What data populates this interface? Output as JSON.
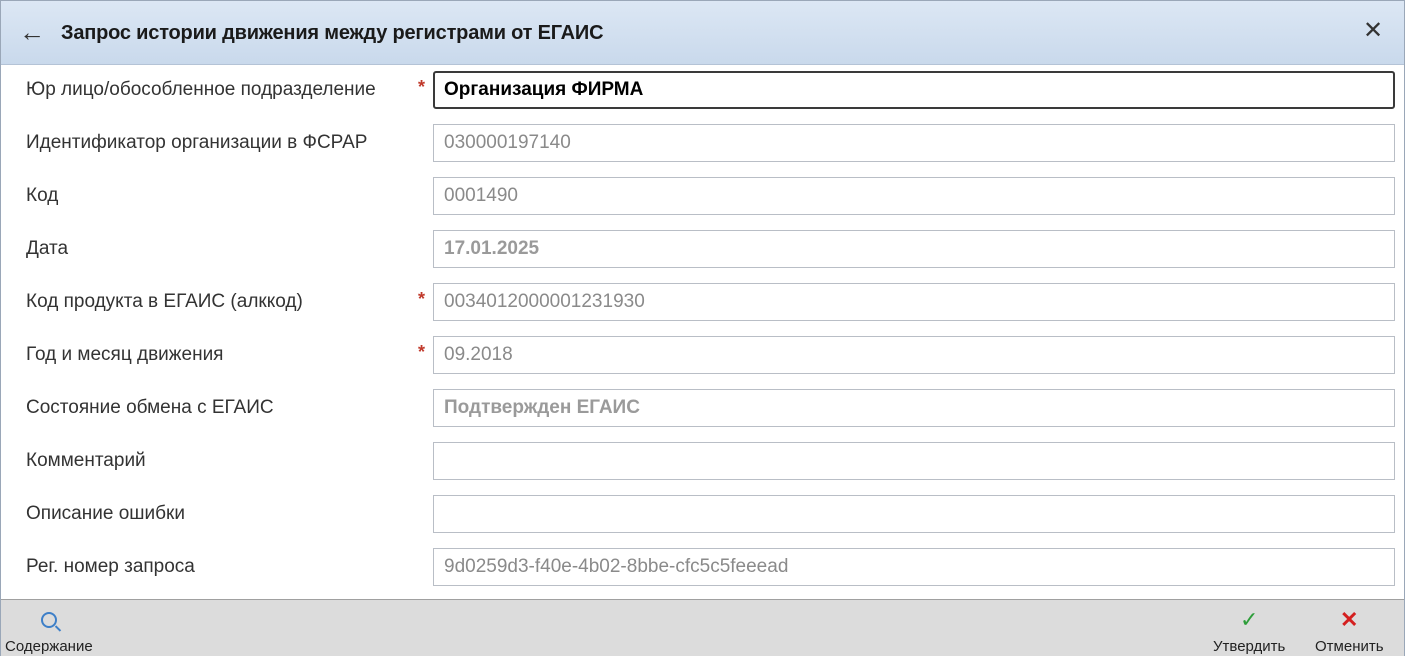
{
  "title": "Запрос истории движения между регистрами от ЕГАИС",
  "icons": {
    "back": "←",
    "close": "✕",
    "ok": "✓",
    "cancel": "✕"
  },
  "fields": [
    {
      "label": "Юр лицо/обособленное подразделение",
      "value": "Организация ФИРМА",
      "required": "*"
    },
    {
      "label": "Идентификатор организации в ФСРАР",
      "value": "030000197140",
      "required": ""
    },
    {
      "label": "Код",
      "value": "0001490",
      "required": ""
    },
    {
      "label": "Дата",
      "value": "17.01.2025",
      "required": ""
    },
    {
      "label": "Код продукта в ЕГАИС (алккод)",
      "value": "0034012000001231930",
      "required": "*"
    },
    {
      "label": "Год и месяц движения",
      "value": "09.2018",
      "required": "*"
    },
    {
      "label": "Состояние обмена с ЕГАИС",
      "value": "Подтвержден ЕГАИС",
      "required": ""
    },
    {
      "label": "Комментарий",
      "value": "",
      "required": ""
    },
    {
      "label": "Описание ошибки",
      "value": "",
      "required": ""
    },
    {
      "label": "Рег. номер запроса",
      "value": "9d0259d3-f40e-4b02-8bbe-cfc5c5feeead",
      "required": ""
    }
  ],
  "toolbar": {
    "contents_label": "Содержание",
    "approve_label": "Утвердить",
    "cancel_label": "Отменить"
  },
  "colors": {
    "title_bg": "#c9d9ec",
    "required": "#c0392b",
    "ok": "#2e9e3a",
    "cancel": "#d42020"
  }
}
